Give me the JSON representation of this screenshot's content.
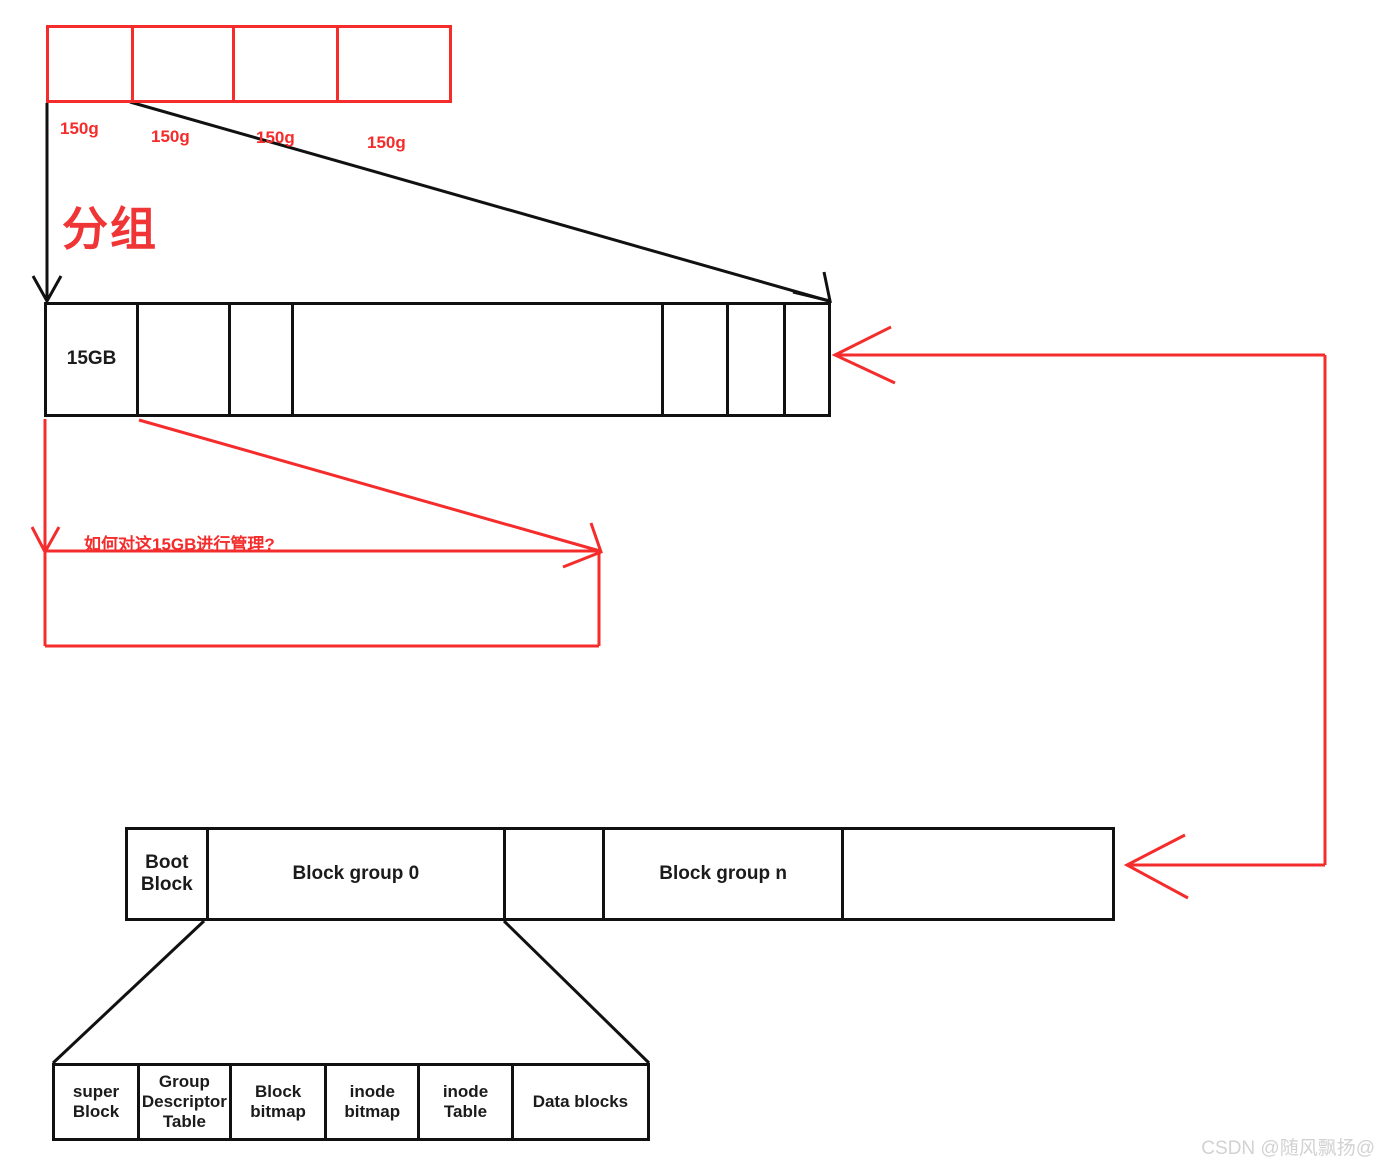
{
  "colors": {
    "red": "#f52c2c",
    "black": "#111111",
    "watermark": "#d2d2d2"
  },
  "top_strip": {
    "name": "disk-partition-strip",
    "cells": [
      "",
      "",
      "",
      ""
    ],
    "size_labels": [
      "150g",
      "150g",
      "150g",
      "150g"
    ]
  },
  "group_label": "分组",
  "disk_bar": {
    "name": "fifteen-gb-disk-bar",
    "cells": [
      "15GB",
      "",
      "",
      "",
      "",
      "",
      ""
    ]
  },
  "question": "如何对这15GB进行管理?",
  "block_group_bar": {
    "name": "block-group-bar",
    "cells": [
      "Boot\nBlock",
      "Block group 0",
      "",
      "Block group n",
      ""
    ]
  },
  "detail_bar": {
    "name": "block-group-detail-bar",
    "cells": [
      "super\nBlock",
      "Group\nDescriptor\nTable",
      "Block\nbitmap",
      "inode\nbitmap",
      "inode\nTable",
      "Data blocks"
    ]
  },
  "watermark": "CSDN @随风飘扬@"
}
